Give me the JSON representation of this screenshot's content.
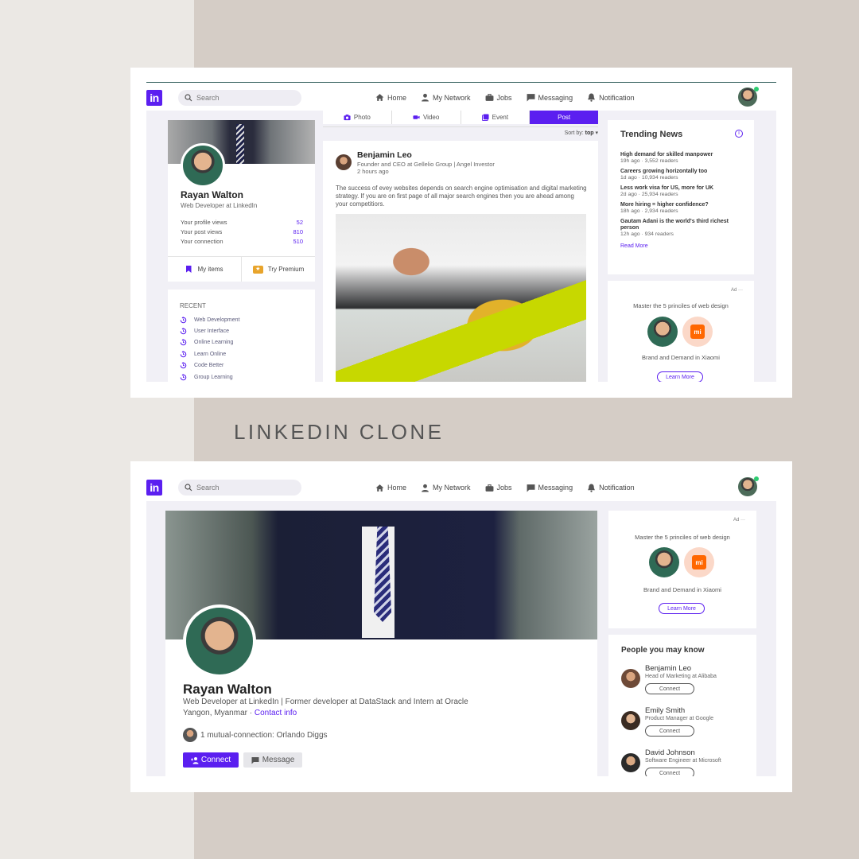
{
  "nav": {
    "search_placeholder": "Search",
    "items": [
      {
        "label": "Home",
        "icon": "home-icon"
      },
      {
        "label": "My Network",
        "icon": "people-icon"
      },
      {
        "label": "Jobs",
        "icon": "briefcase-icon"
      },
      {
        "label": "Messaging",
        "icon": "chat-icon"
      },
      {
        "label": "Notification",
        "icon": "bell-icon"
      }
    ],
    "logo_text": "in"
  },
  "caption": "LINKEDIN CLONE",
  "feed": {
    "profile": {
      "name": "Rayan Walton",
      "title": "Web Developer at LinkedIn",
      "stats": [
        {
          "label": "Your profile views",
          "value": "52"
        },
        {
          "label": "Your post views",
          "value": "810"
        },
        {
          "label": "Your connection",
          "value": "510"
        }
      ],
      "my_items": "My items",
      "try_premium": "Try Premium"
    },
    "recent": {
      "heading": "RECENT",
      "items": [
        "Web Development",
        "User Interface",
        "Online Learning",
        "Learn Online",
        "Code Better",
        "Group Learning"
      ]
    },
    "post_tabs": [
      "Photo",
      "Video",
      "Event",
      "Post"
    ],
    "sort": {
      "label": "Sort by:",
      "value": "top"
    },
    "post": {
      "author": "Benjamin Leo",
      "subtitle": "Founder and CEO at Gellelio Group | Angel Investor",
      "time": "2 hours ago",
      "text": "The success of evey websites depends on search engine optimisation and digital marketing strategy. If you are on first page of all major search engines then you are ahead among your competitiors."
    },
    "trending": {
      "title": "Trending News",
      "items": [
        {
          "title": "High demand for skilled manpower",
          "meta": "19h ago · 3,552 readers"
        },
        {
          "title": "Careers growing horizontally too",
          "meta": "1d ago · 10,934 readers"
        },
        {
          "title": "Less work visa for US, more for UK",
          "meta": "2d ago · 25,934 readers"
        },
        {
          "title": "More hiring = higher confidence?",
          "meta": "18h ago · 2,934 readers"
        },
        {
          "title": "Gautam Adani is the world's third richest person",
          "meta": "12h ago · 934 readers"
        }
      ],
      "read_more": "Read More"
    },
    "ad": {
      "label": "Ad ···",
      "text": "Master the 5 princiles of web design",
      "brand": "Brand and Demand in Xiaomi",
      "logo": "mi",
      "button": "Learn More"
    }
  },
  "profile_page": {
    "name": "Rayan Walton",
    "title": "Web Developer at LinkedIn | Former developer at DataStack and Intern at Oracle",
    "location": "Yangon, Myanmar · ",
    "contact_info": "Contact info",
    "mutual": "1 mutual-connection: Orlando Diggs",
    "connect": "Connect",
    "message": "Message",
    "ad": {
      "label": "Ad ···",
      "text": "Master the 5 princiles of web design",
      "brand": "Brand and Demand in Xiaomi",
      "logo": "mi",
      "button": "Learn More"
    },
    "people": {
      "title": "People you may know",
      "items": [
        {
          "name": "Benjamin Leo",
          "sub": "Head of Marketing at Alibaba",
          "button": "Connect"
        },
        {
          "name": "Emily Smith",
          "sub": "Product Manager at Google",
          "button": "Connect"
        },
        {
          "name": "David Johnson",
          "sub": "Software Engineer at Microsoft",
          "button": "Connect"
        }
      ]
    }
  },
  "colors": {
    "accent": "#5b1ff0",
    "background": "#d5cdc6",
    "panel": "#f1f0f6"
  }
}
